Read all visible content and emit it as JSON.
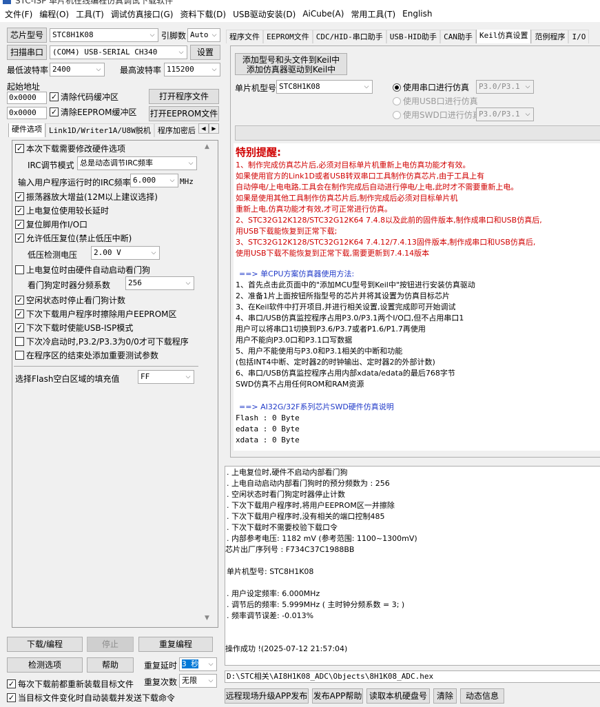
{
  "window_title": "STC-ISP 单片机在线编程仿真调试下载软件",
  "menu": [
    "文件(F)",
    "编程(O)",
    "工具(T)",
    "调试仿真接口(G)",
    "资料下载(D)",
    "USB驱动安装(D)",
    "AiCube(A)",
    "常用工具(T)",
    "English"
  ],
  "left": {
    "chip_label": "芯片型号",
    "chip_value": "STC8H1K08",
    "pin_label": "引脚数",
    "pin_value": "Auto",
    "scan_label": "扫描串口",
    "port_value": "(COM4) USB-SERIAL CH340",
    "settings_label": "设置",
    "min_baud_label": "最低波特率",
    "min_baud_value": "2400",
    "max_baud_label": "最高波特率",
    "max_baud_value": "115200",
    "start_addr_label": "起始地址",
    "addr1": "0x0000",
    "clear_code_label": "清除代码缓冲区",
    "open_prog_label": "打开程序文件",
    "addr2": "0x0000",
    "clear_eeprom_label": "清除EEPROM缓冲区",
    "open_eeprom_label": "打开EEPROM文件",
    "tabs": [
      "硬件选项",
      "Link1D/Writer1A/U8W脱机",
      "程序加密后"
    ],
    "options": {
      "modify_hw": "本次下载需要修改硬件选项",
      "irc_mode_label": "IRC调节模式",
      "irc_mode_value": "总是动态调节IRC频率",
      "irc_freq_label": "输入用户程序运行时的IRC频率",
      "irc_freq_value": "6.000",
      "irc_unit": "MHz",
      "osc_gain": "振荡器放大增益(12M以上建议选择)",
      "reset_delay": "上电复位使用较长延时",
      "reset_io": "复位脚用作I/O口",
      "lvr": "允许低压复位(禁止低压中断)",
      "lvd_label": "低压检测电压",
      "lvd_value": "2.00 V",
      "wdt_auto": "上电复位时由硬件自动启动看门狗",
      "wdt_div_label": "看门狗定时器分频系数",
      "wdt_div_value": "256",
      "idle_wdt": "空闲状态时停止看门狗计数",
      "erase_eeprom": "下次下载用户程序时擦除用户EEPROM区",
      "usb_isp": "下次下载时使能USB-ISP模式",
      "cold_boot": "下次冷启动时,P3.2/P3.3为0/0才可下载程序",
      "add_params": "在程序区的结束处添加重要测试参数",
      "flash_fill_label": "选择Flash空白区域的填充值",
      "flash_fill_value": "FF"
    },
    "download_label": "下载/编程",
    "stop_label": "停止",
    "reprogram_label": "重复编程",
    "detect_label": "检测选项",
    "help_label": "帮助",
    "repeat_delay_label": "重复延时",
    "repeat_delay_value": "3 秒",
    "repeat_count_label": "重复次数",
    "repeat_count_value": "无限",
    "reload_label": "每次下载前都重新装载目标文件",
    "auto_send_label": "当目标文件变化时自动装载并发送下载命令"
  },
  "right": {
    "tabs": [
      "程序文件",
      "EEPROM文件",
      "CDC/HID-串口助手",
      "USB-HID助手",
      "CAN助手",
      "Keil仿真设置",
      "范例程序",
      "I/O"
    ],
    "add_keil_line1": "添加型号和头文件到Keil中",
    "add_keil_line2": "添加仿真器驱动到Keil中",
    "mcu_label": "单片机型号",
    "mcu_value": "STC8H1K08",
    "radio_serial": "使用串口进行仿真",
    "radio_serial_port": "P3.0/P3.1",
    "radio_usb": "使用USB口进行仿真",
    "radio_swd": "使用SWD口进行仿真",
    "radio_swd_port": "P3.0/P3.1",
    "notice_title": "特别提醒:",
    "notice": [
      "1、制作完成仿真芯片后,必须对目标单片机重新上电仿真功能才有效。",
      "    如果使用官方的Link1D或者USB转双串口工具制作仿真芯片,由于工具上有",
      "    自动停电/上电电路,工具会在制作完成后自动进行停电/上电,此时才不需要重新上电。",
      "    如果是使用其他工具制作仿真芯片后,制作完成后必须对目标单片机",
      "    重新上电,仿真功能才有效,才可正常进行仿真。",
      "2、STC32G12K128/STC32G12K64  7.4.8以及此前的固件版本,制作成串口和USB仿真后,",
      "    用USB下载能恢复到正常下载;",
      "3、STC32G12K128/STC32G12K64  7.4.12/7.4.13固件版本,制作成串口和USB仿真后,",
      "    使用USB下载不能恢复到正常下载,需要更新到7.4.14版本"
    ],
    "single_cpu_title": "==> 单CPU方案仿真器使用方法:",
    "steps": [
      "1、首先点击此页面中的\"添加MCU型号到Keil中\"按钮进行安装仿真驱动",
      "2、准备1片上面按钮所指型号的芯片并将其设置为仿真目标芯片",
      "3、在Keil软件中打开项目,并进行相关设置,设置完成即可开始调试",
      "4、串口/USB仿真监控程序占用P3.0/P3.1两个I/O口,但不占用串口1",
      "    用户可以将串口1切换到P3.6/P3.7或者P1.6/P1.7再使用",
      "    用户不能向P3.0口和P3.1口写数据",
      "5、用户不能使用与P3.0和P3.1相关的中断和功能",
      "   (包括INT4中断、定时器2的时钟输出、定时器2的外部计数)",
      "6、串口/USB仿真监控程序占用内部xdata/edata的最后768字节",
      "    SWD仿真不占用任何ROM和RAM资源"
    ],
    "swd_title": "==> AI32G/32F系列芯片SWD硬件仿真说明",
    "mem": [
      "Flash : 0 Byte",
      "edata : 0 Byte",
      "xdata : 0 Byte"
    ],
    "log": [
      "  . 上电复位时,硬件不启动内部看门狗",
      "  . 上电自动启动内部看门狗时的预分频数为 : 256",
      "  . 空闲状态时看门狗定时器停止计数",
      "  . 下次下载用户程序时,将用户EEPROM区一并擦除",
      "  . 下次下载用户程序时,没有相关的端口控制485",
      "  . 下次下载时不需要校验下载口令",
      "  . 内部参考电压: 1182 mV (参考范围: 1100~1300mV)",
      "芯片出厂序列号 : F734C37C1988BB",
      "",
      "  单片机型号: STC8H1K08",
      "",
      "  . 用户设定频率: 6.000MHz",
      "  . 调节后的频率: 5.999MHz ( 主时钟分频系数 = 3; )",
      "  . 频率调节误差: -0.013%",
      "",
      "",
      "",
      "操作成功 !(2025-07-12 21:57:04)"
    ],
    "file_path": "D:\\STC相关\\AI8H1K08_ADC\\Objects\\8H1K08_ADC.hex",
    "bottom_buttons": [
      "远程现场升级APP发布",
      "发布APP帮助",
      "读取本机硬盘号",
      "清除",
      "动态信息"
    ]
  }
}
